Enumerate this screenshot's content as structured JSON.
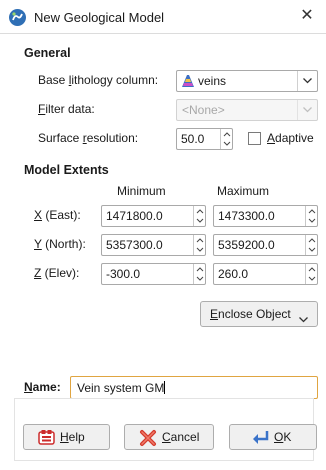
{
  "window": {
    "title": "New Geological Model",
    "close_glyph": "✕"
  },
  "general": {
    "heading": "General",
    "base_lithology": {
      "label_pre": "Base ",
      "label_u": "l",
      "label_post": "ithology column:",
      "value": "veins",
      "icon": "lithology-icon"
    },
    "filter_data": {
      "label_u": "F",
      "label_post": "ilter data:",
      "value": "<None>",
      "enabled": false
    },
    "surface_resolution": {
      "label_pre": "Surface ",
      "label_u": "r",
      "label_post": "esolution:",
      "value": "50.0"
    },
    "adaptive": {
      "label_u": "A",
      "label_post": "daptive",
      "checked": false
    }
  },
  "extents": {
    "heading": "Model Extents",
    "col_min": "Minimum",
    "col_max": "Maximum",
    "rows": [
      {
        "label_u": "X",
        "label_post": " (East):",
        "min": "1471800.0",
        "max": "1473300.0"
      },
      {
        "label_u": "Y",
        "label_post": " (North):",
        "min": "5357300.0",
        "max": "5359200.0"
      },
      {
        "label_u": "Z",
        "label_post": " (Elev):",
        "min": "-300.0",
        "max": "260.0"
      }
    ],
    "enclose_u": "E",
    "enclose_post": "nclose Object"
  },
  "name": {
    "label_u": "N",
    "label_post": "ame:",
    "value": "Vein system GM"
  },
  "buttons": {
    "help": {
      "label_u": "H",
      "label_post": "elp",
      "icon": "help-icon"
    },
    "cancel": {
      "label_u": "C",
      "label_post": "ancel",
      "icon": "cancel-icon"
    },
    "ok": {
      "label_u": "O",
      "label_post": "K",
      "icon": "ok-icon"
    }
  },
  "colors": {
    "accent_border": "#e0a541",
    "title_icon": "#2f6fb5",
    "cancel_red": "#d33a2c",
    "help_red": "#cc2b2b"
  }
}
